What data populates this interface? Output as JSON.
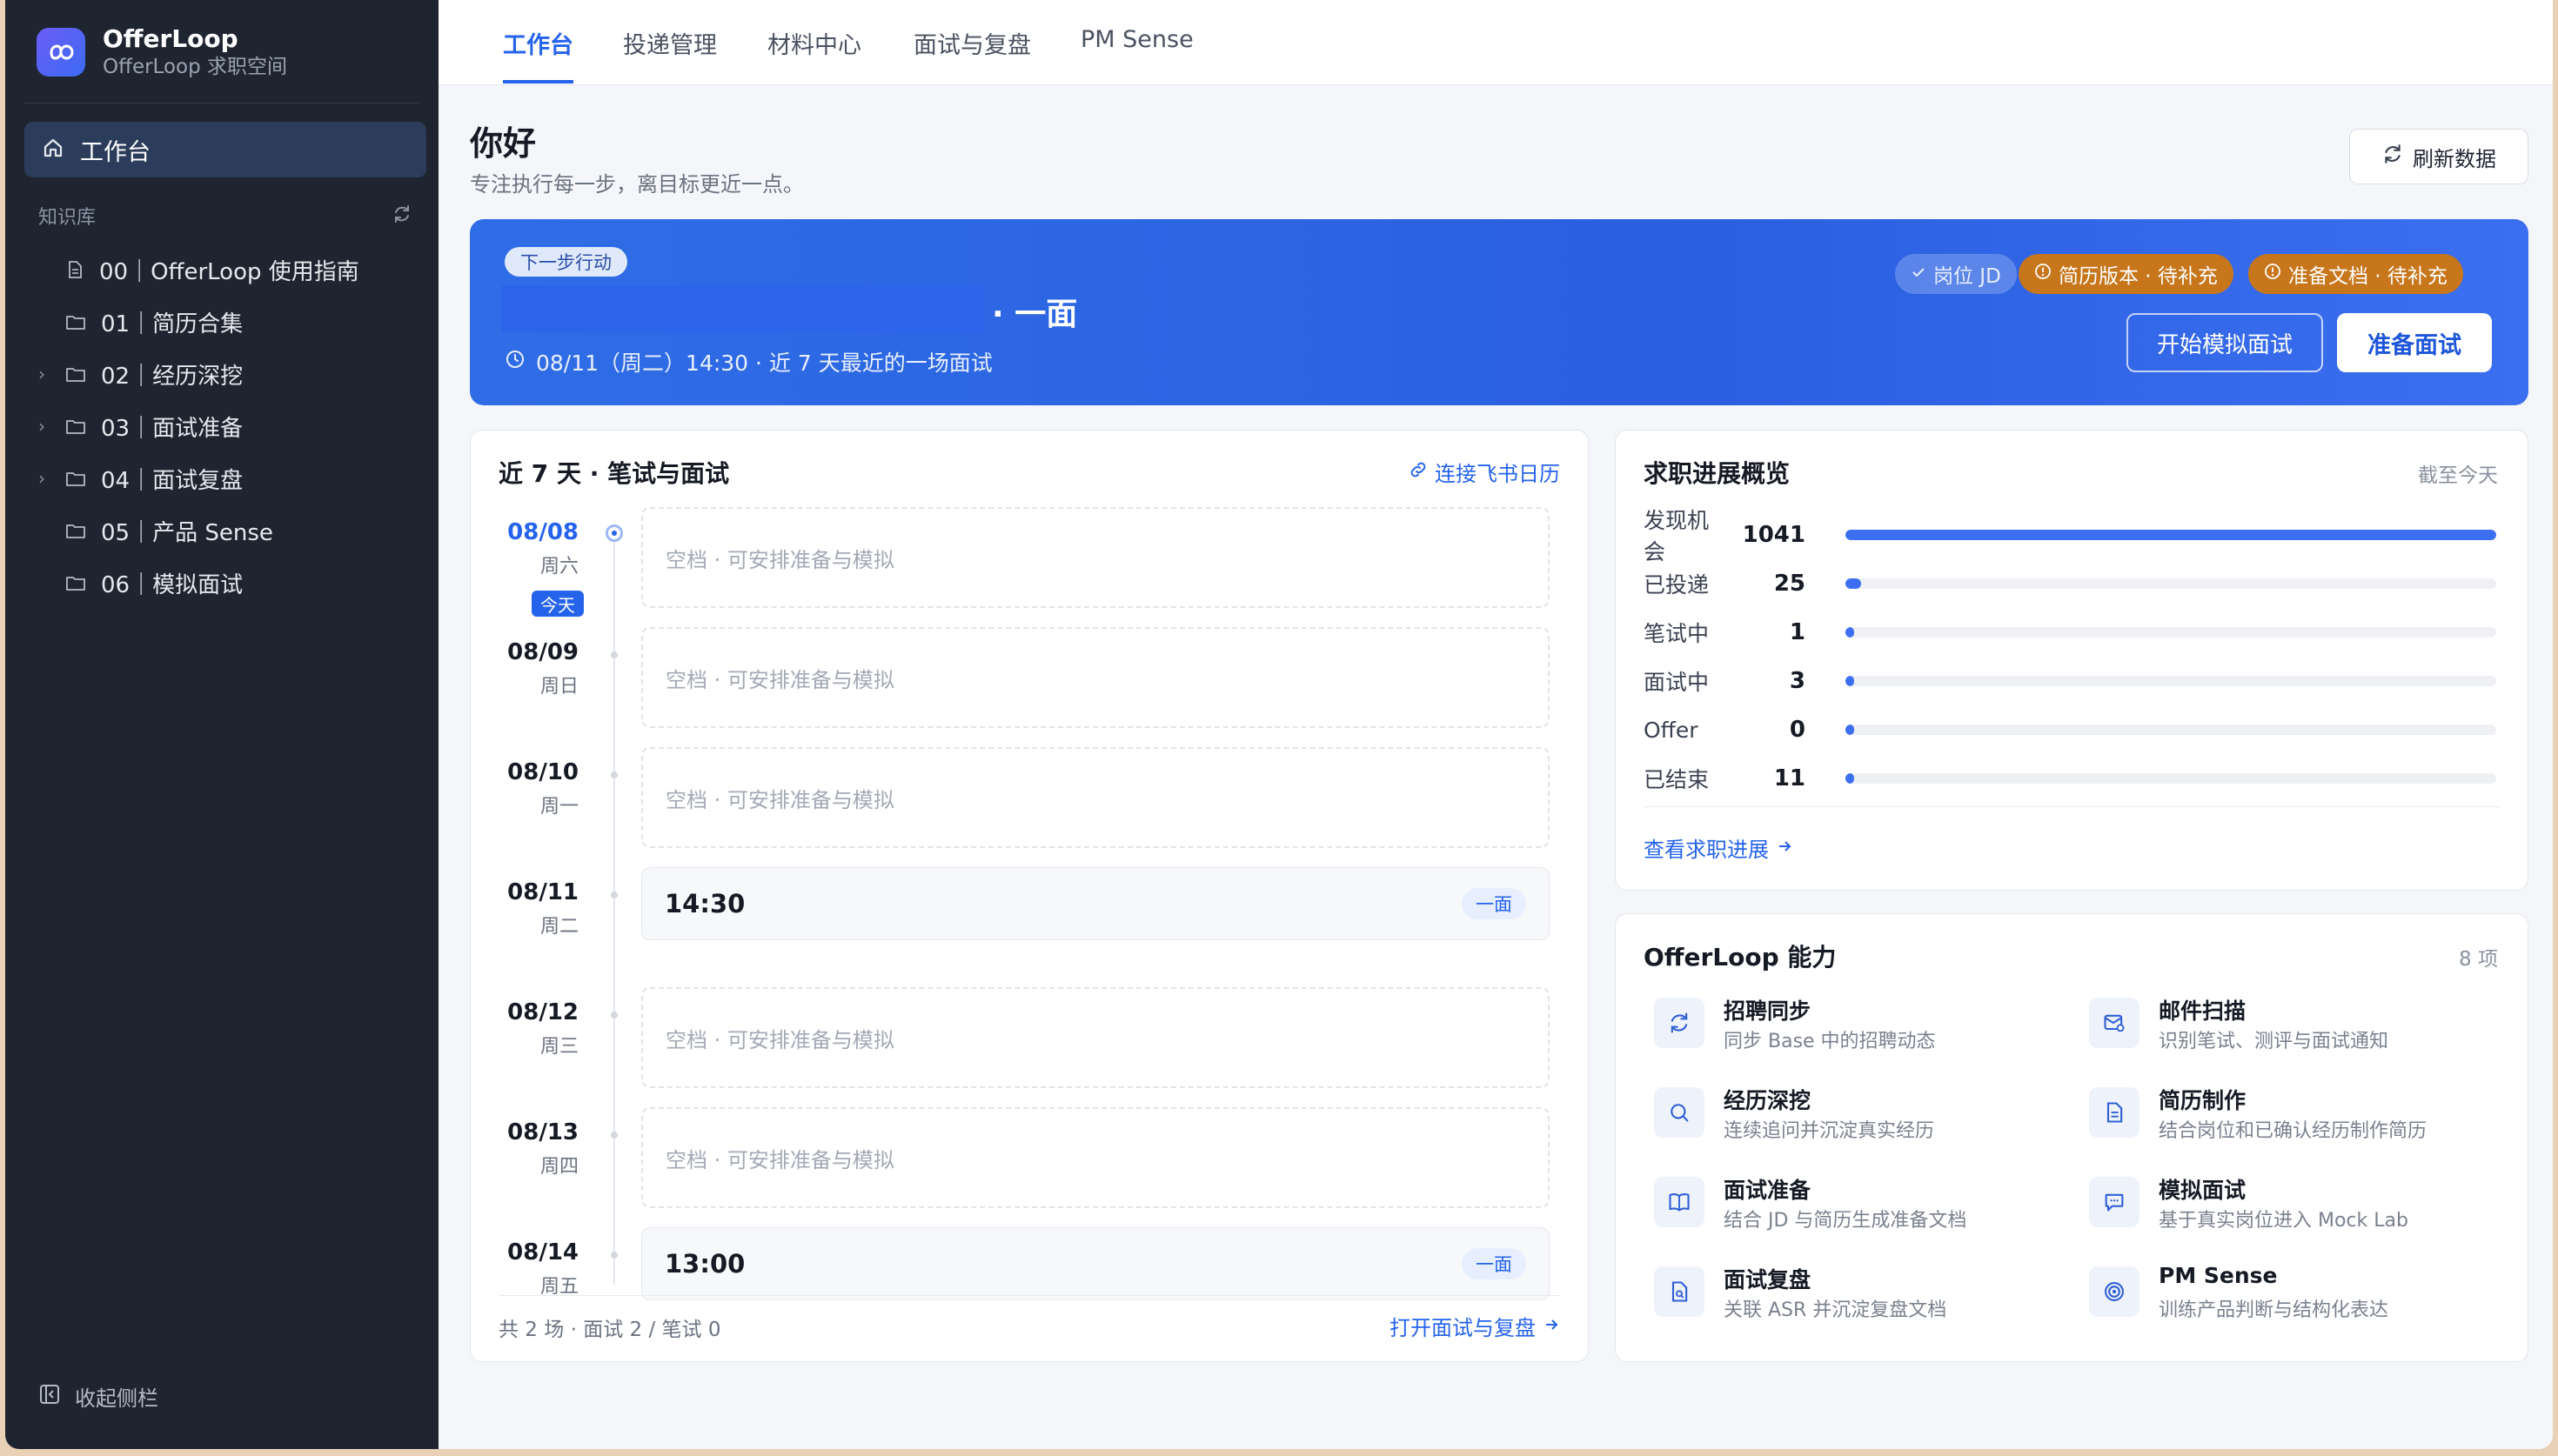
{
  "brand": {
    "name": "OfferLoop",
    "subtitle": "OfferLoop 求职空间"
  },
  "sidebar": {
    "active_item": "工作台",
    "kb_heading": "知识库",
    "items": [
      {
        "label": "00｜OfferLoop 使用指南",
        "icon": "file-icon",
        "expandable": false
      },
      {
        "label": "01｜简历合集",
        "icon": "folder-icon",
        "expandable": false
      },
      {
        "label": "02｜经历深挖",
        "icon": "folder-icon",
        "expandable": true
      },
      {
        "label": "03｜面试准备",
        "icon": "folder-icon",
        "expandable": true
      },
      {
        "label": "04｜面试复盘",
        "icon": "folder-icon",
        "expandable": true
      },
      {
        "label": "05｜产品 Sense",
        "icon": "folder-icon",
        "expandable": false
      },
      {
        "label": "06｜模拟面试",
        "icon": "folder-icon",
        "expandable": false
      }
    ],
    "collapse_label": "收起侧栏"
  },
  "nav": {
    "tabs": [
      "工作台",
      "投递管理",
      "材料中心",
      "面试与复盘",
      "PM Sense"
    ],
    "active": 0
  },
  "header": {
    "greeting": "你好",
    "subtitle": "专注执行每一步，离目标更近一点。",
    "refresh_label": "刷新数据"
  },
  "banner": {
    "badge": "下一步行动",
    "title_suffix": "· 一面",
    "meta": "08/11（周二）14:30 · 近 7 天最近的一场面试",
    "chips": [
      "岗位 JD",
      "简历版本 · 待补充",
      "准备文档 · 待补充"
    ],
    "btn_mock": "开始模拟面试",
    "btn_prepare": "准备面试"
  },
  "schedule": {
    "title": "近 7 天 · 笔试与面试",
    "link": "连接飞书日历",
    "today_label": "今天",
    "empty_text": "空档 · 可安排准备与模拟",
    "days": [
      {
        "date": "08/08",
        "week": "周六",
        "today": true,
        "event": null
      },
      {
        "date": "08/09",
        "week": "周日",
        "today": false,
        "event": null
      },
      {
        "date": "08/10",
        "week": "周一",
        "today": false,
        "event": null
      },
      {
        "date": "08/11",
        "week": "周二",
        "today": false,
        "event": {
          "time": "14:30",
          "tag": "一面"
        }
      },
      {
        "date": "08/12",
        "week": "周三",
        "today": false,
        "event": null
      },
      {
        "date": "08/13",
        "week": "周四",
        "today": false,
        "event": null
      },
      {
        "date": "08/14",
        "week": "周五",
        "today": false,
        "event": {
          "time": "13:00",
          "tag": "一面"
        }
      }
    ],
    "footer": "共 2 场 · 面试 2 / 笔试 0",
    "footer_link": "打开面试与复盘"
  },
  "progress": {
    "title": "求职进展概览",
    "aside": "截至今天",
    "rows": [
      {
        "label": "发现机会",
        "value": 1041
      },
      {
        "label": "已投递",
        "value": 25
      },
      {
        "label": "笔试中",
        "value": 1
      },
      {
        "label": "面试中",
        "value": 3
      },
      {
        "label": "Offer",
        "value": 0
      },
      {
        "label": "已结束",
        "value": 11
      }
    ],
    "link": "查看求职进展"
  },
  "capabilities": {
    "title": "OfferLoop 能力",
    "count": "8 项",
    "items": [
      {
        "title": "招聘同步",
        "desc": "同步 Base 中的招聘动态",
        "icon": "sync-icon"
      },
      {
        "title": "邮件扫描",
        "desc": "识别笔试、测评与面试通知",
        "icon": "mail-scan-icon"
      },
      {
        "title": "经历深挖",
        "desc": "连续追问并沉淀真实经历",
        "icon": "search-icon"
      },
      {
        "title": "简历制作",
        "desc": "结合岗位和已确认经历制作简历",
        "icon": "document-icon"
      },
      {
        "title": "面试准备",
        "desc": "结合 JD 与简历生成准备文档",
        "icon": "book-icon"
      },
      {
        "title": "模拟面试",
        "desc": "基于真实岗位进入 Mock Lab",
        "icon": "chat-icon"
      },
      {
        "title": "面试复盘",
        "desc": "关联 ASR 并沉淀复盘文档",
        "icon": "file-search-icon"
      },
      {
        "title": "PM Sense",
        "desc": "训练产品判断与结构化表达",
        "icon": "target-icon"
      }
    ]
  },
  "colors": {
    "accent": "#2563eb",
    "sidebar": "#1f2530",
    "warn": "#c7761b"
  }
}
